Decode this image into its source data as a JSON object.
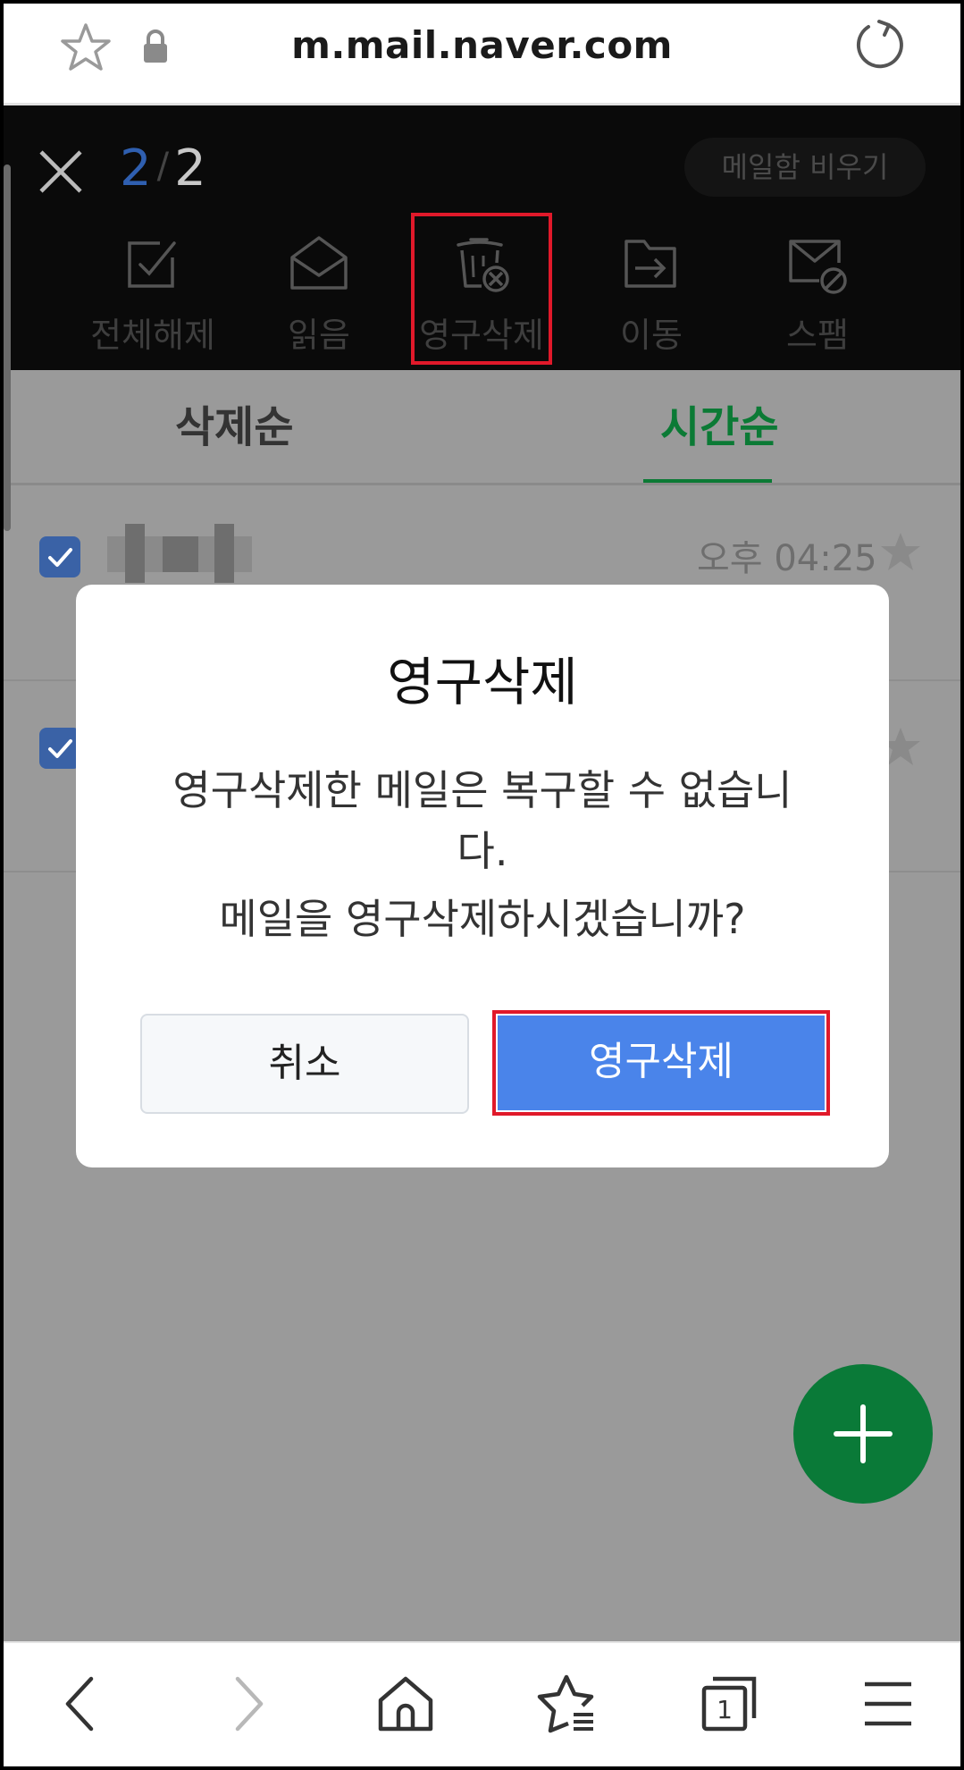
{
  "browser": {
    "url": "m.mail.naver.com"
  },
  "toolbar": {
    "counter_current": "2",
    "counter_sep": "/",
    "counter_total": "2",
    "empty_mailbox": "메일함 비우기",
    "actions": [
      {
        "label": "전체해제",
        "icon": "checkbox-icon"
      },
      {
        "label": "읽음",
        "icon": "envelope-open-icon"
      },
      {
        "label": "영구삭제",
        "icon": "trash-delete-icon"
      },
      {
        "label": "이동",
        "icon": "folder-move-icon"
      },
      {
        "label": "스팸",
        "icon": "mail-block-icon"
      }
    ]
  },
  "tabs": {
    "by_deleted": "삭제순",
    "by_time": "시간순"
  },
  "mail_list": [
    {
      "time": "오후 04:25",
      "checked": true
    },
    {
      "time": "",
      "checked": true
    }
  ],
  "dialog": {
    "title": "영구삭제",
    "message_line1": "영구삭제한 메일은 복구할 수 없습니",
    "message_line2": "다.",
    "message_line3": "메일을 영구삭제하시겠습니까?",
    "cancel_label": "취소",
    "confirm_label": "영구삭제"
  },
  "colors": {
    "accent_green": "#0b7a35",
    "confirm_blue": "#4a84ea",
    "highlight_red": "#e0192a"
  }
}
